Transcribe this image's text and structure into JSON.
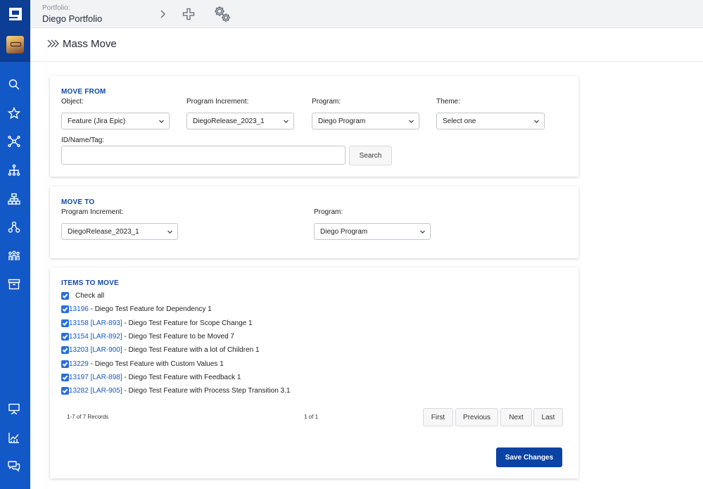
{
  "topbar": {
    "portfolio_label": "Portfolio:",
    "portfolio_name": "Diego Portfolio"
  },
  "page": {
    "title": "Mass Move"
  },
  "move_from": {
    "heading": "MOVE FROM",
    "object_label": "Object:",
    "object_value": "Feature (Jira Epic)",
    "pi_label": "Program Increment:",
    "pi_value": "DiegoRelease_2023_1",
    "program_label": "Program:",
    "program_value": "Diego Program",
    "theme_label": "Theme:",
    "theme_value": "Select one",
    "search_label": "ID/Name/Tag:",
    "search_value": "",
    "search_button": "Search"
  },
  "move_to": {
    "heading": "MOVE TO",
    "pi_label": "Program Increment:",
    "pi_value": "DiegoRelease_2023_1",
    "program_label": "Program:",
    "program_value": "Diego Program"
  },
  "items": {
    "heading": "ITEMS TO MOVE",
    "check_all_label": "Check all",
    "rows": [
      {
        "link": "13196",
        "rest": " - Diego Test Feature for Dependency 1"
      },
      {
        "link": "13158 [LAR-893]",
        "rest": " - Diego Test Feature for Scope Change 1"
      },
      {
        "link": "13154 [LAR-892]",
        "rest": " - Diego Test Feature to be Moved 7"
      },
      {
        "link": "13203 [LAR-900]",
        "rest": " - Diego Test Feature with a lot of Children 1"
      },
      {
        "link": "13229",
        "rest": " - Diego Test Feature with Custom Values 1"
      },
      {
        "link": "13197 [LAR-898]",
        "rest": " - Diego Test Feature with Feedback 1"
      },
      {
        "link": "13282 [LAR-905]",
        "rest": " - Diego Test Feature with Process Step Transition 3.1"
      }
    ],
    "records": "1-7 of 7 Records",
    "page_of": "1 of 1",
    "pager": {
      "first": "First",
      "previous": "Previous",
      "next": "Next",
      "last": "Last"
    },
    "save_button": "Save Changes"
  },
  "colors": {
    "sidebar": "#1358c7",
    "sidebar_dark": "#0b3e94",
    "accent": "#114aa6",
    "primary_button": "#0b43a4",
    "link": "#1559c4"
  },
  "icons": {
    "sidebar": [
      "search-icon",
      "star-icon",
      "network-icon",
      "hierarchy-icon",
      "org-chart-icon",
      "cluster-icon",
      "team-icon",
      "archive-icon",
      "presentation-icon",
      "analytics-icon",
      "chat-icon"
    ],
    "topbar": [
      "chevron-right-icon",
      "plus-icon",
      "gears-icon"
    ]
  }
}
